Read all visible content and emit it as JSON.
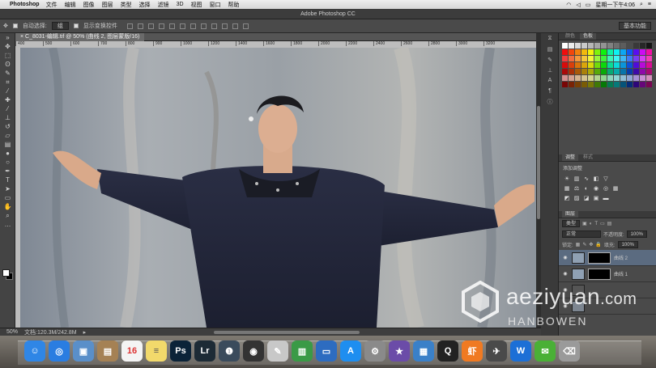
{
  "menubar": {
    "app_name": "Photoshop",
    "items": [
      "文件",
      "编辑",
      "图像",
      "图层",
      "类型",
      "选择",
      "滤镜",
      "3D",
      "视图",
      "窗口",
      "帮助"
    ],
    "clock": "星期一下午4:06"
  },
  "window": {
    "title": "Adobe Photoshop CC"
  },
  "options_bar": {
    "auto_select_label": "自动选择:",
    "auto_select_value": "组",
    "show_transform_label": "显示变换控件",
    "workspace": "基本功能"
  },
  "document": {
    "tab_label": "C_8031-编辑.tif @ 50% (曲线 2, 图层蒙版/16)",
    "ruler_ticks": [
      "400",
      "500",
      "600",
      "700",
      "800",
      "900",
      "1000",
      "1200",
      "1400",
      "1600",
      "1800",
      "2000",
      "2200",
      "2400",
      "2600",
      "2800",
      "3000",
      "3200"
    ]
  },
  "status_bar": {
    "zoom": "50%",
    "doc_info": "文档:120.3M/242.8M"
  },
  "panels": {
    "color_tabs": [
      "颜色",
      "色板"
    ],
    "adjust_tabs": [
      "调整",
      "样式"
    ],
    "adjust_title": "添加调整",
    "layers_tabs": [
      "图层"
    ],
    "filter_kind": "类型",
    "blend_mode": "正常",
    "opacity_label": "不透明度:",
    "opacity_value": "100%",
    "lock_label": "锁定:",
    "fill_label": "填充:",
    "fill_value": "100%",
    "layers": [
      {
        "name": "曲线 2",
        "selected": true
      },
      {
        "name": "曲线 1",
        "selected": false
      },
      {
        "name": "",
        "selected": false
      },
      {
        "name": "",
        "selected": false
      }
    ]
  },
  "watermark": {
    "text": "aeziyuan",
    "suffix": ".com",
    "sub": "HANBOWEN"
  },
  "dock": {
    "apps": [
      {
        "name": "finder",
        "color": "#2f86e6",
        "glyph": "☺"
      },
      {
        "name": "safari",
        "color": "#2a7de1",
        "glyph": "◎"
      },
      {
        "name": "preview",
        "color": "#5a8fc9",
        "glyph": "▣"
      },
      {
        "name": "contacts",
        "color": "#a58154",
        "glyph": "▤"
      },
      {
        "name": "calendar",
        "color": "#f4f4f4",
        "glyph": "16"
      },
      {
        "name": "notes",
        "color": "#f2d96b",
        "glyph": "≡"
      },
      {
        "name": "photoshop",
        "color": "#0b2338",
        "glyph": "Ps"
      },
      {
        "name": "lightroom",
        "color": "#1d2b36",
        "glyph": "Lr"
      },
      {
        "name": "app-1",
        "color": "#3a4b5c",
        "glyph": "❶"
      },
      {
        "name": "dvd",
        "color": "#333333",
        "glyph": "◉"
      },
      {
        "name": "app-2",
        "color": "#c8c8c8",
        "glyph": "✎"
      },
      {
        "name": "numbers",
        "color": "#3a9a46",
        "glyph": "▥"
      },
      {
        "name": "keynote",
        "color": "#2d6cc0",
        "glyph": "▭"
      },
      {
        "name": "app-store",
        "color": "#1e8ef0",
        "glyph": "A"
      },
      {
        "name": "system-preferences",
        "color": "#8a8a8a",
        "glyph": "⚙"
      },
      {
        "name": "imovie",
        "color": "#6b4ca8",
        "glyph": "★"
      },
      {
        "name": "screen-share",
        "color": "#3a80c8",
        "glyph": "▦"
      },
      {
        "name": "qq",
        "color": "#222222",
        "glyph": "Q"
      },
      {
        "name": "xiami",
        "color": "#f07a22",
        "glyph": "虾"
      },
      {
        "name": "launchpad",
        "color": "#4a4a4a",
        "glyph": "✈"
      },
      {
        "name": "app-3",
        "color": "#1c6fd6",
        "glyph": "W"
      },
      {
        "name": "wechat",
        "color": "#4ab036",
        "glyph": "✉"
      },
      {
        "name": "trash",
        "color": "#9a9a9a",
        "glyph": "⌫"
      }
    ]
  }
}
